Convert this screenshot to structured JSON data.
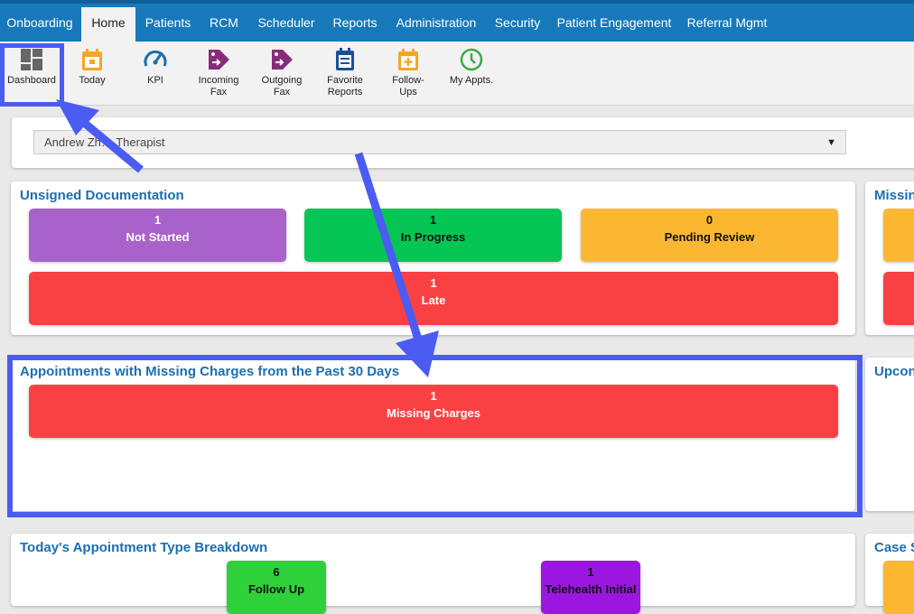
{
  "nav": {
    "items": [
      "Onboarding",
      "Home",
      "Patients",
      "RCM",
      "Scheduler",
      "Reports",
      "Administration",
      "Security",
      "Patient Engagement",
      "Referral Mgmt"
    ],
    "active": "Home"
  },
  "toolbar": {
    "items": [
      {
        "label": "Dashboard",
        "icon": "dashboard-icon",
        "color": "#666666"
      },
      {
        "label": "Today",
        "icon": "calendar-today-icon",
        "color": "#f5a623"
      },
      {
        "label": "KPI",
        "icon": "gauge-icon",
        "color": "#1b6fb0"
      },
      {
        "label": "Incoming\nFax",
        "icon": "incoming-fax-icon",
        "color": "#8a2a7a"
      },
      {
        "label": "Outgoing\nFax",
        "icon": "outgoing-fax-icon",
        "color": "#8a2a7a"
      },
      {
        "label": "Favorite\nReports",
        "icon": "report-icon",
        "color": "#1b4f9b"
      },
      {
        "label": "Follow-\nUps",
        "icon": "calendar-plus-icon",
        "color": "#f5a623"
      },
      {
        "label": "My Appts.",
        "icon": "clock-icon",
        "color": "#3cab47"
      }
    ]
  },
  "provider_select": {
    "value": "Andrew Zh… Therapist"
  },
  "unsigned": {
    "title": "Unsigned Documentation",
    "tiles": [
      {
        "count": "1",
        "label": "Not Started"
      },
      {
        "count": "1",
        "label": "In Progress"
      },
      {
        "count": "0",
        "label": "Pending Review"
      },
      {
        "count": "1",
        "label": "Late"
      }
    ]
  },
  "missing_charges": {
    "title": "Appointments with Missing Charges from the Past 30 Days",
    "count": "1",
    "label": "Missing Charges"
  },
  "breakdown": {
    "title": "Today's Appointment Type Breakdown",
    "tiles": [
      {
        "count": "6",
        "label": "Follow Up"
      },
      {
        "count": "1",
        "label": "Telehealth Initial"
      }
    ]
  },
  "right_panels": {
    "missing_title": "Missin",
    "upcoming_title": "Upcon",
    "case_title": "Case S"
  },
  "colors": {
    "annotation": "#4a5cf2",
    "nav": "#1779ba",
    "title": "#1b6fb0"
  }
}
